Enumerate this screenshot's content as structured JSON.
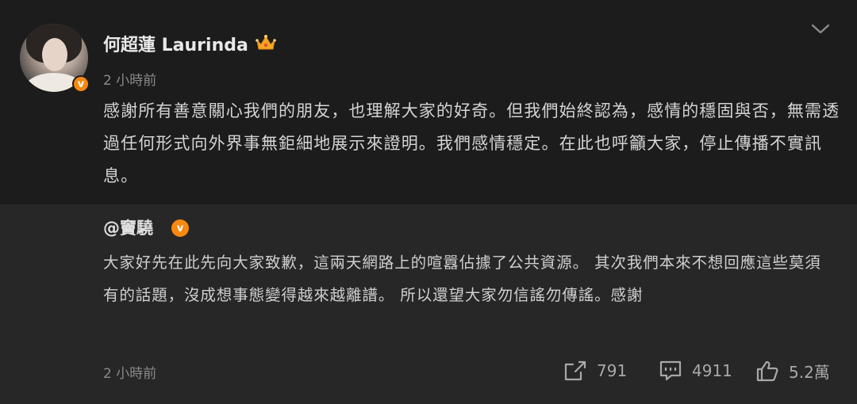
{
  "post": {
    "author": "何超蓮 Laurinda",
    "time": "2 小時前",
    "text": "感謝所有善意關心我們的朋友，也理解大家的好奇。但我們始終認為，感情的穩固與否，無需透過任何形式向外界事無鉅細地展示來證明。我們感情穩定。在此也呼籲大家，停止傳播不實訊息。"
  },
  "repost": {
    "author": "@竇驍",
    "text": "大家好先在此先向大家致歉，這兩天網路上的喧囂佔據了公共資源。 其次我們本來不想回應這些莫須有的話題，沒成想事態變得越來越離譜。 所以還望大家勿信謠勿傳謠。感謝",
    "time": "2 小時前"
  },
  "actions": {
    "share_count": "791",
    "comment_count": "4911",
    "like_count": "5.2萬"
  },
  "colors": {
    "accent": "#f7890f",
    "background": "#1c1c1c",
    "repost_background": "#272727"
  },
  "icons": [
    "crown-icon",
    "chevron-down-icon",
    "verified-icon",
    "share-icon",
    "comment-icon",
    "like-icon"
  ]
}
